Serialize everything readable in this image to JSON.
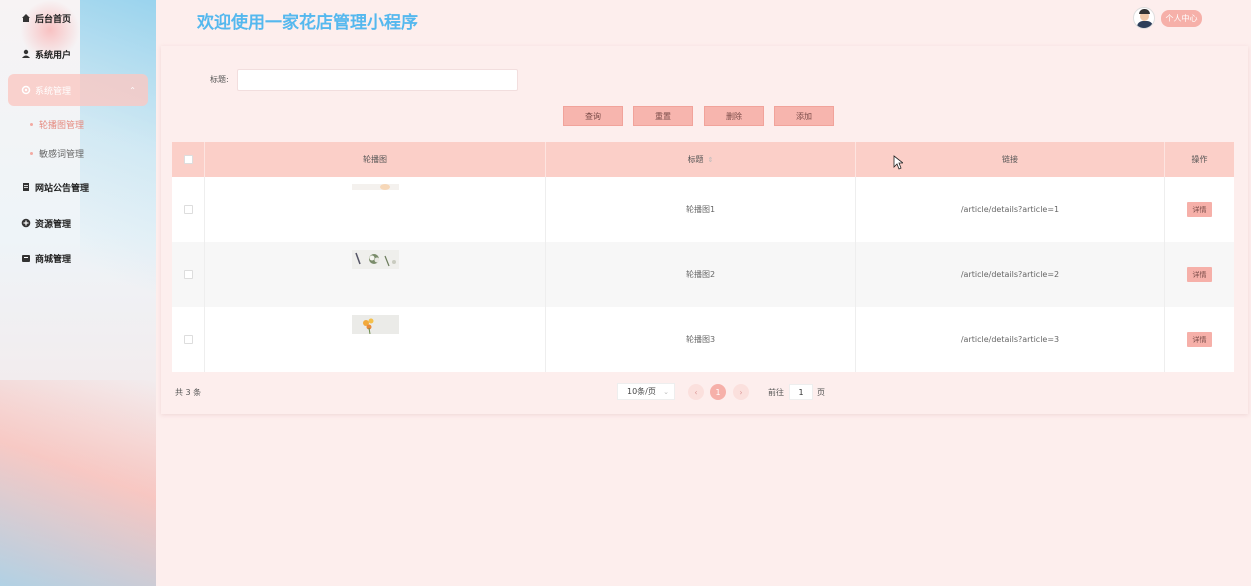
{
  "app": {
    "title": "欢迎使用一家花店管理小程序",
    "profile_label": "个人中心"
  },
  "sidebar": {
    "items": [
      {
        "label": "后台首页",
        "icon": "home-icon"
      },
      {
        "label": "系统用户",
        "icon": "user-icon"
      },
      {
        "label": "系统管理",
        "icon": "settings-icon"
      },
      {
        "label": "网站公告管理",
        "icon": "document-icon"
      },
      {
        "label": "资源管理",
        "icon": "plus-circle-icon"
      },
      {
        "label": "商城管理",
        "icon": "shop-icon"
      }
    ],
    "sub_items": [
      {
        "label": "轮播图管理",
        "active": true
      },
      {
        "label": "敏感词管理",
        "active": false
      }
    ]
  },
  "search": {
    "label": "标题:",
    "value": ""
  },
  "toolbar": {
    "query_label": "查询",
    "reset_label": "重置",
    "delete_label": "删除",
    "add_label": "添加"
  },
  "table": {
    "headers": {
      "image": "轮播图",
      "title": "标题",
      "link": "链接",
      "action": "操作"
    },
    "rows": [
      {
        "title": "轮播图1",
        "link": "/article/details?article=1",
        "action": "详情"
      },
      {
        "title": "轮播图2",
        "link": "/article/details?article=2",
        "action": "详情"
      },
      {
        "title": "轮播图3",
        "link": "/article/details?article=3",
        "action": "详情"
      }
    ]
  },
  "pagination": {
    "total_text": "共 3 条",
    "page_size": "10条/页",
    "current_page": "1",
    "goto_prefix": "前往",
    "goto_value": "1",
    "goto_suffix": "页"
  },
  "colors": {
    "accent": "#f6b0a9",
    "title": "#55b8ee",
    "header_bg": "#fbcfc8",
    "page_bg": "#fdeeed"
  }
}
